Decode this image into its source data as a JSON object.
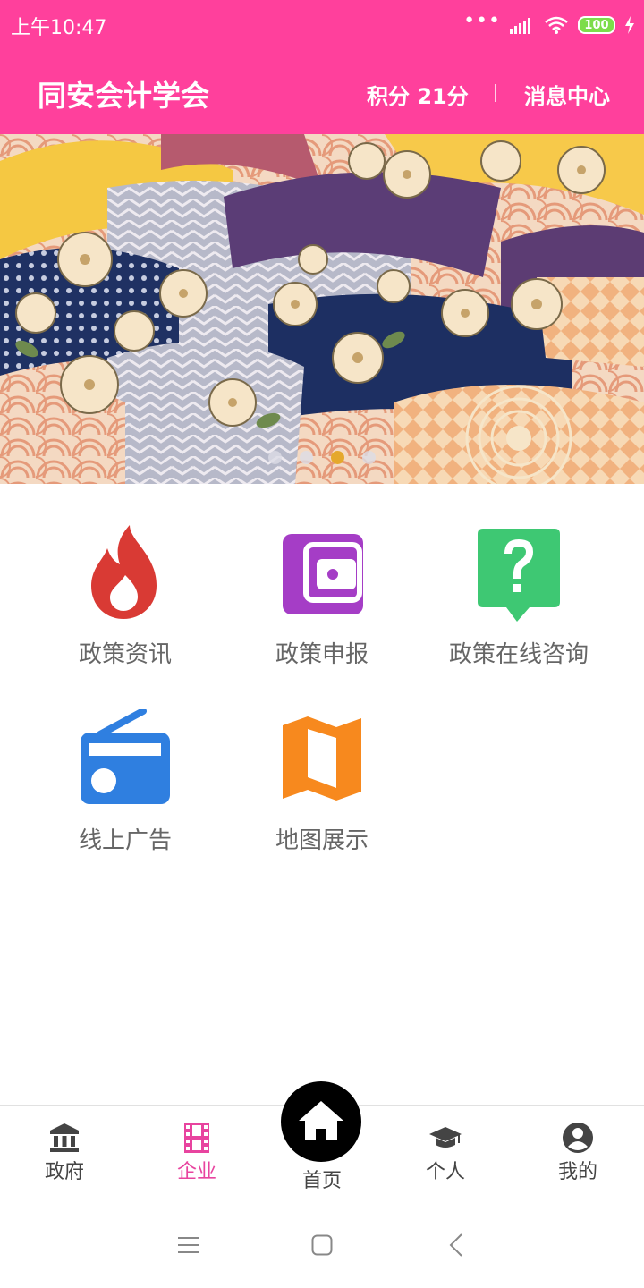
{
  "status_bar": {
    "time": "上午10:47",
    "battery": "100"
  },
  "header": {
    "title": "同安会计学会",
    "points": "积分 21分",
    "messages": "消息中心"
  },
  "banner": {
    "indicator_count": 4,
    "active_index": 2
  },
  "grid": [
    {
      "label": "政策资讯",
      "icon": "flame-icon",
      "color": "#d93a34"
    },
    {
      "label": "政策申报",
      "icon": "wallet-icon",
      "color": "#a53dc6"
    },
    {
      "label": "政策在线咨询",
      "icon": "question-bubble-icon",
      "color": "#3ec873"
    },
    {
      "label": "线上广告",
      "icon": "radio-icon",
      "color": "#2f7fe0"
    },
    {
      "label": "地图展示",
      "icon": "map-icon",
      "color": "#f7891e"
    }
  ],
  "tabs": [
    {
      "label": "政府",
      "icon": "bank-icon"
    },
    {
      "label": "企业",
      "icon": "film-icon",
      "active": true
    },
    {
      "label": "首页",
      "icon": "home-icon"
    },
    {
      "label": "个人",
      "icon": "graduation-cap-icon"
    },
    {
      "label": "我的",
      "icon": "user-circle-icon"
    }
  ],
  "colors": {
    "brand": "#ff409c",
    "active_tab": "#e8449f",
    "indicator_active": "#e5a82c"
  }
}
